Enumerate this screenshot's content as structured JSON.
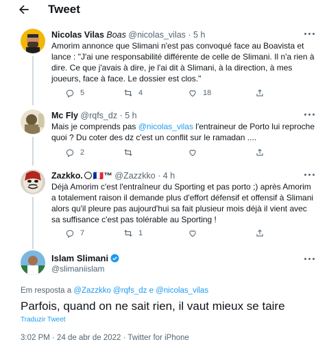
{
  "header": {
    "title": "Tweet"
  },
  "tweets": [
    {
      "name": "Nicolas Vilas",
      "name_italic": "Boas",
      "handle": "@nicolas_vilas",
      "time": "· 5 h",
      "text": "Amorim annonce que Slimani n'est pas convoqué face au Boavista et lance : \"J'ai une responsabilité différente de celle de Slimani. Il n'a rien à dire. Ce que j'avais à dire, je l'ai dit à Slimani, à la direction, à mes joueurs, face à face. Le dossier est clos.\"",
      "replies": "5",
      "retweets": "4",
      "likes": "18"
    },
    {
      "name": "Mc Fly",
      "handle": "@rqfs_dz",
      "time": "· 5 h",
      "text_before": "Mais je comprends pas ",
      "mention": "@nicolas_vilas",
      "text_after": " l'entraineur de Porto lui reproche quoi ? Du coter des dz c'est un conflit sur le ramadan ....",
      "replies": "2",
      "retweets": "",
      "likes": ""
    },
    {
      "name": "Zazkko.",
      "name_emoji": "🇫🇷™",
      "handle": "@Zazzkko",
      "time": "· 4 h",
      "text": "Déjà Amorim c'est l'entraîneur du Sporting et pas porto ;) après Amorim a totalement raison il demande plus d'effort défensif et offensif à  Slimani alors qu'il pleure pas aujourd'hui sa fait plusieur mois déjà il vient avec sa suffisance c'est pas tolérable au Sporting !",
      "replies": "7",
      "retweets": "1",
      "likes": ""
    }
  ],
  "main_tweet": {
    "name": "Islam Slimani",
    "handle": "@slimaniislam",
    "reply_prefix": "Em resposta a ",
    "reply_to": "@Zazzkko @rqfs_dz e @nicolas_vilas",
    "text": "Parfois, quand on ne sait rien, il vaut mieux se taire",
    "translate": "Traduzir Tweet",
    "meta": "3:02 PM · 24 de abr de 2022 · Twitter for iPhone"
  },
  "icons": {
    "back": "arrow-left-icon",
    "more": "more-horizontal-icon",
    "reply": "reply-icon",
    "retweet": "retweet-icon",
    "like": "heart-icon",
    "share": "share-icon",
    "verified": "verified-badge-icon"
  },
  "colors": {
    "accent": "#1d9bf0",
    "text": "#0f1419",
    "muted": "#536471",
    "line": "#cfd9de"
  }
}
